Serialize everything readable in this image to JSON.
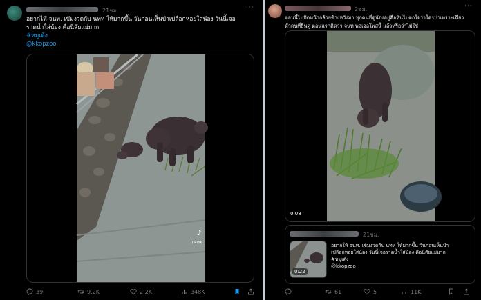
{
  "left_post": {
    "time": "21ชม.",
    "more": "···",
    "body_line1": "อยากไห้ จนท. เข้มงวดกับ นทท ให้มากขึ้น วันก่อนเห็นป่าเปลือกหอยใส่น้อง วันนี้เจอ",
    "body_line2": "ราดน้ำใส่น้อง คือนิสัยแย่มาก",
    "hashtag": "#หมูเด้ง",
    "mention": "@kkopzoo",
    "actions": {
      "replies": "39",
      "reposts": "9.2K",
      "likes": "2.2K",
      "views": "348K"
    },
    "watermark": "TikTok"
  },
  "right_post": {
    "time": "2ชม.",
    "more": "···",
    "body_line1": "ตอนนี้ไปปัดหน้ากล้วยข้างหวังมา ทุกคนที่ดูน้องอยู่คือหันไปตกใจว่าใครปาเพราะเฉียว",
    "body_line2": "หัวคนที่ยืนดู ตอนแรกคิดว่า จนท พอเจอโพสนี้ แล้วหรือว่าไม่ใช่",
    "duration": "0:08",
    "quote": {
      "time": "21ชม.",
      "line1": "อยากให้ จนท. เข้มงวดกับ นทท ให้มากขึ้น วันก่อนเห็นป่า",
      "line2": "เปลือกหอยใส่น้อง วันนี้เจอราดน้ำใส่น้อง คือนิสัยแย่มาก",
      "hashtag": "#หมูเด้ง",
      "mention": "@kkopzoo",
      "duration": "0:22"
    },
    "actions": {
      "reposts": "61",
      "likes": "5",
      "views": "11K"
    }
  }
}
